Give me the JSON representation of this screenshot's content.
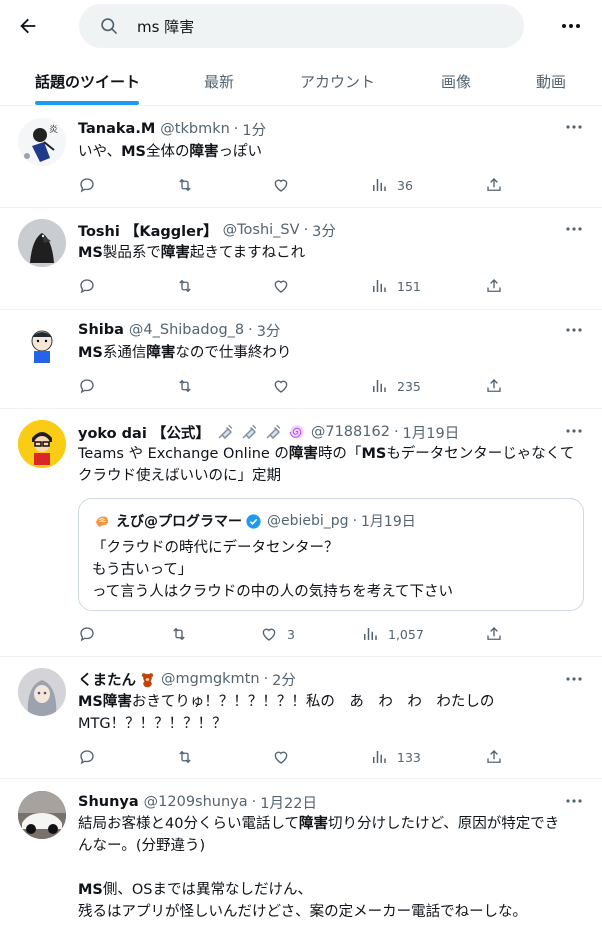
{
  "search": {
    "query": "ms 障害"
  },
  "tabs": [
    {
      "label": "話題のツイート"
    },
    {
      "label": "最新"
    },
    {
      "label": "アカウント"
    },
    {
      "label": "画像"
    },
    {
      "label": "動画"
    }
  ],
  "tweets": [
    {
      "name": "Tanaka.M",
      "handle": "@tkbmkn",
      "sep": "·",
      "time": "1分",
      "text_parts": [
        "いや、",
        "MS",
        "全体の",
        "障害",
        "っぽい"
      ],
      "counts": {
        "views": "36"
      }
    },
    {
      "name": "Toshi 【Kaggler】",
      "handle": "@Toshi_SV",
      "sep": "·",
      "time": "3分",
      "text_parts": [
        "MS",
        "製品系で",
        "障害",
        "起きてますねこれ"
      ],
      "counts": {
        "views": "151"
      }
    },
    {
      "name": "Shiba",
      "handle": "@4_Shibadog_8",
      "sep": "·",
      "time": "3分",
      "text_parts": [
        "MS",
        "系通信",
        "障害",
        "なので仕事終わり"
      ],
      "counts": {
        "views": "235"
      }
    },
    {
      "name": "yoko dai 【公式】",
      "handle": "@7188162",
      "sep": "·",
      "time": "1月19日",
      "text_parts": [
        "Teams や Exchange Online の",
        "障害",
        "時の「",
        "MS",
        "もデータセンターじゃなくて",
        "クラウド使えばいいのに」定期"
      ],
      "counts": {
        "likes": "3",
        "views": "1,057"
      },
      "quote": {
        "name": "えび@プログラマー",
        "handle": "@ebiebi_pg",
        "sep": "·",
        "time": "1月19日",
        "lines": [
          "「クラウドの時代にデータセンター？",
          "もう古いって」",
          "って言う人はクラウドの中の人の気持ちを考えて下さい"
        ]
      }
    },
    {
      "name": "くまたん",
      "handle": "@mgmgkmtn",
      "sep": "·",
      "time": "2分",
      "text_parts": [
        "MS障害",
        "おきてりゅ！？！？！？！私の　あ　わ　わ　わたしの",
        "MTG！？！？！？！？"
      ],
      "counts": {
        "views": "133"
      }
    },
    {
      "name": "Shunya",
      "handle": "@1209shunya",
      "sep": "·",
      "time": "1月22日",
      "text_parts": [
        "結局お客様と40分くらい電話して",
        "障害",
        "切り分けしたけど、原因が特定でき",
        "んなー。(分野違う)",
        "MS",
        "側、OSまでは異常なしだけん、",
        "残るはアプリが怪しいんだけどさ、案の定メーカー電話でねーしな。"
      ]
    }
  ],
  "colors": {
    "accent": "#1d9bf0",
    "text": "#0f1419",
    "secondary": "#536471",
    "border": "#eff3f4",
    "verified": "#1d9bf0"
  }
}
